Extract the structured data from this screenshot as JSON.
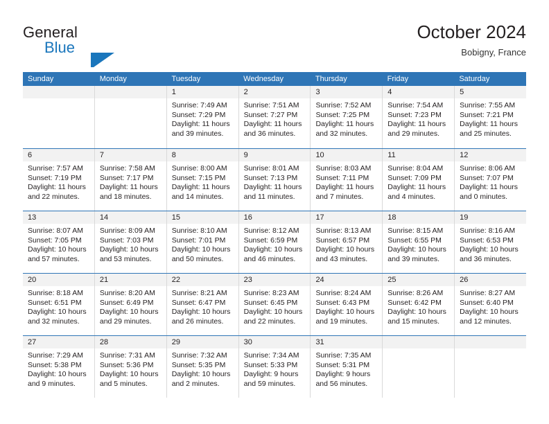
{
  "brand": {
    "name_top": "General",
    "name_bottom": "Blue",
    "mark": "triangle-flag-logo"
  },
  "header": {
    "month_title": "October 2024",
    "location": "Bobigny, France"
  },
  "colors": {
    "header_blue": "#2e75b6",
    "brand_blue": "#1a76bc",
    "day_head_gray": "#f2f2f2",
    "cell_border": "#d9d9d9",
    "text": "#231f20"
  },
  "weekday_headers": [
    "Sunday",
    "Monday",
    "Tuesday",
    "Wednesday",
    "Thursday",
    "Friday",
    "Saturday"
  ],
  "labels": {
    "sunrise_prefix": "Sunrise:",
    "sunset_prefix": "Sunset:",
    "daylight_prefix": "Daylight:"
  },
  "weeks": [
    [
      {
        "day": "",
        "lines": []
      },
      {
        "day": "",
        "lines": []
      },
      {
        "day": "1",
        "lines": [
          "Sunrise: 7:49 AM",
          "Sunset: 7:29 PM",
          "Daylight: 11 hours",
          "and 39 minutes."
        ]
      },
      {
        "day": "2",
        "lines": [
          "Sunrise: 7:51 AM",
          "Sunset: 7:27 PM",
          "Daylight: 11 hours",
          "and 36 minutes."
        ]
      },
      {
        "day": "3",
        "lines": [
          "Sunrise: 7:52 AM",
          "Sunset: 7:25 PM",
          "Daylight: 11 hours",
          "and 32 minutes."
        ]
      },
      {
        "day": "4",
        "lines": [
          "Sunrise: 7:54 AM",
          "Sunset: 7:23 PM",
          "Daylight: 11 hours",
          "and 29 minutes."
        ]
      },
      {
        "day": "5",
        "lines": [
          "Sunrise: 7:55 AM",
          "Sunset: 7:21 PM",
          "Daylight: 11 hours",
          "and 25 minutes."
        ]
      }
    ],
    [
      {
        "day": "6",
        "lines": [
          "Sunrise: 7:57 AM",
          "Sunset: 7:19 PM",
          "Daylight: 11 hours",
          "and 22 minutes."
        ]
      },
      {
        "day": "7",
        "lines": [
          "Sunrise: 7:58 AM",
          "Sunset: 7:17 PM",
          "Daylight: 11 hours",
          "and 18 minutes."
        ]
      },
      {
        "day": "8",
        "lines": [
          "Sunrise: 8:00 AM",
          "Sunset: 7:15 PM",
          "Daylight: 11 hours",
          "and 14 minutes."
        ]
      },
      {
        "day": "9",
        "lines": [
          "Sunrise: 8:01 AM",
          "Sunset: 7:13 PM",
          "Daylight: 11 hours",
          "and 11 minutes."
        ]
      },
      {
        "day": "10",
        "lines": [
          "Sunrise: 8:03 AM",
          "Sunset: 7:11 PM",
          "Daylight: 11 hours",
          "and 7 minutes."
        ]
      },
      {
        "day": "11",
        "lines": [
          "Sunrise: 8:04 AM",
          "Sunset: 7:09 PM",
          "Daylight: 11 hours",
          "and 4 minutes."
        ]
      },
      {
        "day": "12",
        "lines": [
          "Sunrise: 8:06 AM",
          "Sunset: 7:07 PM",
          "Daylight: 11 hours",
          "and 0 minutes."
        ]
      }
    ],
    [
      {
        "day": "13",
        "lines": [
          "Sunrise: 8:07 AM",
          "Sunset: 7:05 PM",
          "Daylight: 10 hours",
          "and 57 minutes."
        ]
      },
      {
        "day": "14",
        "lines": [
          "Sunrise: 8:09 AM",
          "Sunset: 7:03 PM",
          "Daylight: 10 hours",
          "and 53 minutes."
        ]
      },
      {
        "day": "15",
        "lines": [
          "Sunrise: 8:10 AM",
          "Sunset: 7:01 PM",
          "Daylight: 10 hours",
          "and 50 minutes."
        ]
      },
      {
        "day": "16",
        "lines": [
          "Sunrise: 8:12 AM",
          "Sunset: 6:59 PM",
          "Daylight: 10 hours",
          "and 46 minutes."
        ]
      },
      {
        "day": "17",
        "lines": [
          "Sunrise: 8:13 AM",
          "Sunset: 6:57 PM",
          "Daylight: 10 hours",
          "and 43 minutes."
        ]
      },
      {
        "day": "18",
        "lines": [
          "Sunrise: 8:15 AM",
          "Sunset: 6:55 PM",
          "Daylight: 10 hours",
          "and 39 minutes."
        ]
      },
      {
        "day": "19",
        "lines": [
          "Sunrise: 8:16 AM",
          "Sunset: 6:53 PM",
          "Daylight: 10 hours",
          "and 36 minutes."
        ]
      }
    ],
    [
      {
        "day": "20",
        "lines": [
          "Sunrise: 8:18 AM",
          "Sunset: 6:51 PM",
          "Daylight: 10 hours",
          "and 32 minutes."
        ]
      },
      {
        "day": "21",
        "lines": [
          "Sunrise: 8:20 AM",
          "Sunset: 6:49 PM",
          "Daylight: 10 hours",
          "and 29 minutes."
        ]
      },
      {
        "day": "22",
        "lines": [
          "Sunrise: 8:21 AM",
          "Sunset: 6:47 PM",
          "Daylight: 10 hours",
          "and 26 minutes."
        ]
      },
      {
        "day": "23",
        "lines": [
          "Sunrise: 8:23 AM",
          "Sunset: 6:45 PM",
          "Daylight: 10 hours",
          "and 22 minutes."
        ]
      },
      {
        "day": "24",
        "lines": [
          "Sunrise: 8:24 AM",
          "Sunset: 6:43 PM",
          "Daylight: 10 hours",
          "and 19 minutes."
        ]
      },
      {
        "day": "25",
        "lines": [
          "Sunrise: 8:26 AM",
          "Sunset: 6:42 PM",
          "Daylight: 10 hours",
          "and 15 minutes."
        ]
      },
      {
        "day": "26",
        "lines": [
          "Sunrise: 8:27 AM",
          "Sunset: 6:40 PM",
          "Daylight: 10 hours",
          "and 12 minutes."
        ]
      }
    ],
    [
      {
        "day": "27",
        "lines": [
          "Sunrise: 7:29 AM",
          "Sunset: 5:38 PM",
          "Daylight: 10 hours",
          "and 9 minutes."
        ]
      },
      {
        "day": "28",
        "lines": [
          "Sunrise: 7:31 AM",
          "Sunset: 5:36 PM",
          "Daylight: 10 hours",
          "and 5 minutes."
        ]
      },
      {
        "day": "29",
        "lines": [
          "Sunrise: 7:32 AM",
          "Sunset: 5:35 PM",
          "Daylight: 10 hours",
          "and 2 minutes."
        ]
      },
      {
        "day": "30",
        "lines": [
          "Sunrise: 7:34 AM",
          "Sunset: 5:33 PM",
          "Daylight: 9 hours",
          "and 59 minutes."
        ]
      },
      {
        "day": "31",
        "lines": [
          "Sunrise: 7:35 AM",
          "Sunset: 5:31 PM",
          "Daylight: 9 hours",
          "and 56 minutes."
        ]
      },
      {
        "day": "",
        "lines": []
      },
      {
        "day": "",
        "lines": []
      }
    ]
  ]
}
